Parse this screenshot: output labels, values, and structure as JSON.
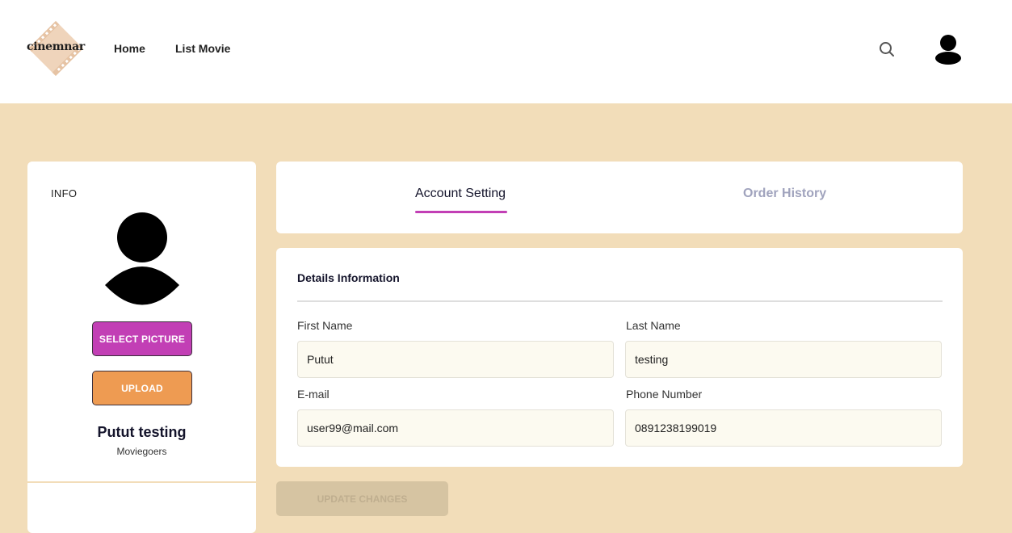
{
  "header": {
    "logo_text": "cinemnar",
    "nav": [
      {
        "label": "Home"
      },
      {
        "label": "List Movie"
      }
    ],
    "search_icon": "search-icon",
    "avatar_icon": "user-icon"
  },
  "profile": {
    "info_label": "INFO",
    "select_picture_label": "SELECT PICTURE",
    "upload_label": "UPLOAD",
    "name": "Putut testing",
    "role": "Moviegoers"
  },
  "tabs": [
    {
      "label": "Account Setting",
      "active": true
    },
    {
      "label": "Order History",
      "active": false
    }
  ],
  "details": {
    "title": "Details Information",
    "fields": [
      {
        "label": "First Name",
        "value": "Putut"
      },
      {
        "label": "Last Name",
        "value": "testing"
      },
      {
        "label": "E-mail",
        "value": "user99@mail.com"
      },
      {
        "label": "Phone Number",
        "value": "0891238199019"
      }
    ]
  },
  "update_button_label": "UPDATE CHANGES",
  "colors": {
    "page_background": "#f2ddb9",
    "accent": "#c23fb5",
    "upload": "#ee9b52",
    "update_disabled": "#d6c4a2"
  }
}
